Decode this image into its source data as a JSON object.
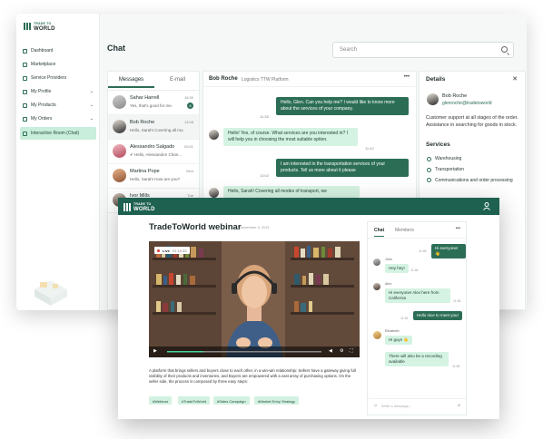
{
  "brand": {
    "line1": "TRADE TO",
    "line2": "WORLD"
  },
  "sidebar": {
    "items": [
      {
        "label": "Dashboard",
        "icon": "dashboard-icon"
      },
      {
        "label": "Marketplace",
        "icon": "marketplace-icon"
      },
      {
        "label": "Service Providers",
        "icon": "service-providers-icon"
      },
      {
        "label": "My Profile",
        "icon": "profile-icon"
      },
      {
        "label": "My Products",
        "icon": "products-icon"
      },
      {
        "label": "My Orders",
        "icon": "orders-icon"
      },
      {
        "label": "Interactive Room (Chat)",
        "icon": "chat-icon"
      }
    ]
  },
  "chat": {
    "title": "Chat",
    "search_placeholder": "Search",
    "tabs": [
      "Messages",
      "E-mail"
    ],
    "conversations": [
      {
        "name": "Sahar Harrell",
        "preview": "Yes, that's good for me.",
        "time": "16:30",
        "badge": "8"
      },
      {
        "name": "Bob Roche",
        "preview": "Hello, Sarah! Covering all mo...",
        "time": "13:08"
      },
      {
        "name": "Alessandro Salgado",
        "preview": "✔ Hello, Alessandro! Chan...",
        "time": "00:01"
      },
      {
        "name": "Martina Pope",
        "preview": "Hello, Sarah! How are you?",
        "time": "Mon"
      },
      {
        "name": "Ivor Mills",
        "preview": "",
        "time": "Tue"
      }
    ],
    "thread": {
      "name": "Bob Roche",
      "company": "Logistics TTW Platform",
      "menu": "•••",
      "messages": [
        {
          "dir": "out",
          "text": "Hello, Glen. Can you help me? I would like to know more about the services of your company.",
          "time": "11:28"
        },
        {
          "dir": "in",
          "text": "Hello! Yes, of course. What services are you interested in? I will help you in choosing the most suitable option.",
          "time": "11:42"
        },
        {
          "dir": "out",
          "text": "I am interested in the transportation services of your products. Tell us more about it please",
          "time": "13:02"
        },
        {
          "dir": "in",
          "text": "Hello, Sarah! Covering all modes of transport, we",
          "time": ""
        }
      ]
    },
    "details": {
      "title": "Details",
      "close": "✕",
      "name": "Bob Roche",
      "email": "glenroche@tradetoworld",
      "desc": "Customer support at all stages of the order. Assistance in searching for goods in stock.",
      "services_title": "Services",
      "services": [
        "Warehousing",
        "Transportation",
        "Communications and order processing"
      ]
    }
  },
  "webinar": {
    "title": "TradeToWorld webinar",
    "date": "November 5, 2021",
    "live": "Live",
    "live_time": "01:10:33",
    "description": "A platform that brings sellers and buyers close to each other, in a win-win relationship: Sellers have a gateway giving full visibility of their products and inventories, and Buyers are empowered with a vast array of purchasing options. On the seller side, the process is composed by three easy steps:",
    "tags": [
      "#Webinar",
      "#TradeToWorld",
      "#Sales Campaign",
      "#Market Entry Strategy"
    ],
    "chat_tabs": [
      "Chat",
      "Members"
    ],
    "chat_menu": "•••",
    "input_placeholder": "Write a message...",
    "messages": [
      {
        "dir": "out",
        "name": "",
        "text": "Hi everyone! 👋",
        "time": "11:48"
      },
      {
        "dir": "in",
        "name": "John",
        "text": "Hey hey!",
        "time": "11:48"
      },
      {
        "dir": "in",
        "name": "Alex",
        "text": "Hi everyone! Alex here from California",
        "time": "11:50"
      },
      {
        "dir": "out",
        "name": "",
        "text": "Hello nice to meet you!",
        "time": "11:51"
      },
      {
        "dir": "in",
        "name": "Elizabeth",
        "text": "Hi guys 👋",
        "time": ""
      },
      {
        "dir": "in",
        "name": "",
        "text": "There will also be a recording available",
        "time": "11:53"
      }
    ]
  },
  "colors": {
    "brand": "#1f6150",
    "accent": "#2c6e55",
    "bubble_in": "#d5f3e2",
    "active_nav": "#c9eedb"
  }
}
